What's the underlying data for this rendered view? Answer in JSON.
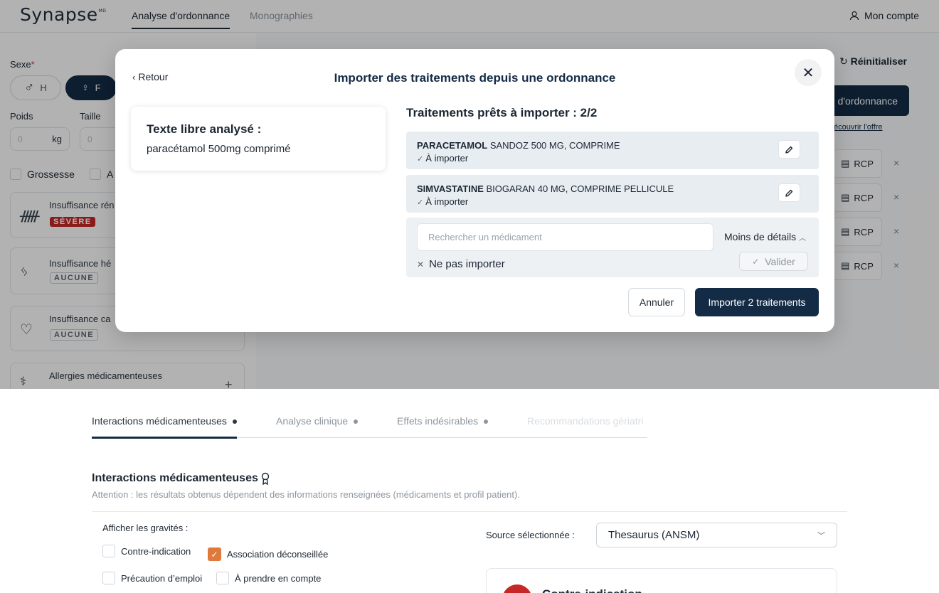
{
  "header": {
    "logo": "Synapse",
    "logo_mark": "MD",
    "tabs": [
      "Analyse d'ordonnance",
      "Monographies"
    ],
    "account": "Mon compte"
  },
  "left": {
    "sexe_label": "Sexe",
    "required_mark": "*",
    "sex_options": [
      "H",
      "F"
    ],
    "selected_sex": "F",
    "poids_label": "Poids",
    "taille_label": "Taille",
    "poids_placeholder": "0",
    "poids_unit": "kg",
    "taille_placeholder": "0",
    "checkbox_grossesse": "Grossesse",
    "checkbox_partial": "A",
    "cards": [
      {
        "title": "Insuffisance rén",
        "badge": "SÉVÈRE",
        "icon": "kidneys-icon"
      },
      {
        "title": "Insuffisance hé",
        "badge": "AUCUNE",
        "icon": "liver-icon"
      },
      {
        "title": "Insuffisance ca",
        "badge": "AUCUNE",
        "icon": "heart-icon"
      },
      {
        "title": "Allergies médicamenteuses",
        "icon": "allergy-icon"
      }
    ],
    "add_symbol": "+"
  },
  "right_bg": {
    "reset": "Réinitialiser",
    "ordonnance_btn": "d'ordonnance",
    "offre_link": "écouvrir l'offre",
    "rcp_label": "RCP",
    "remove_symbol": "×"
  },
  "modal": {
    "back": "Retour",
    "title": "Importer des traitements depuis une ordonnance",
    "close_symbol": "✕",
    "text_card": {
      "heading": "Texte libre analysé :",
      "value": "paracétamol 500mg comprimé"
    },
    "ready_title": "Traitements prêts à importer : 2/2",
    "treatments": [
      {
        "name_bold": "PARACETAMOL",
        "name_rest": "SANDOZ 500 MG, COMPRIME",
        "status": "À importer"
      },
      {
        "name_bold": "SIMVASTATINE",
        "name_rest": "BIOGARAN 40 MG, COMPRIME PELLICULE",
        "status": "À importer"
      }
    ],
    "search_placeholder": "Rechercher un médicament",
    "less_details": "Moins de détails",
    "no_import": "Ne pas importer",
    "validate": "Valider",
    "cancel": "Annuler",
    "import_btn": "Importer 2 traitements"
  },
  "bottom": {
    "tabs": [
      "Interactions médicamenteuses",
      "Analyse clinique",
      "Effets indésirables",
      "Recommandations gériatri"
    ],
    "section_title": "Interactions médicamenteuses",
    "section_subtitle": "Attention : les résultats obtenus dépendent des informations renseignées (médicaments et profil patient).",
    "gravity_label": "Afficher les gravités :",
    "gravities": [
      {
        "label": "Contre-indication",
        "checked": false
      },
      {
        "label": "Association déconseillée",
        "checked": true
      },
      {
        "label": "Précaution d’emploi",
        "checked": false
      },
      {
        "label": "À prendre en compte",
        "checked": false
      }
    ],
    "source_label": "Source sélectionnée :",
    "source_value": "Thesaurus (ANSM)",
    "ci_card_title": "Contre-indication"
  }
}
